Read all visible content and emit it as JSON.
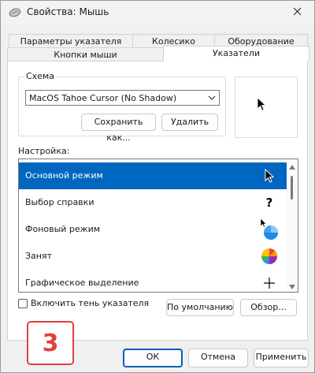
{
  "window": {
    "title": "Свойства: Мышь",
    "icon": "mouse-icon",
    "close_icon": "close-icon"
  },
  "tabs": {
    "row1": [
      "Параметры указателя",
      "Колесико",
      "Оборудование"
    ],
    "row2": [
      "Кнопки мыши",
      "Указатели"
    ],
    "active": "Указатели"
  },
  "scheme": {
    "group_label": "Схема",
    "selected": "MacOS Tahoe Cursor (No Shadow)",
    "save_label": "Сохранить как...",
    "delete_label": "Удалить"
  },
  "customize": {
    "label": "Настройка:",
    "items": [
      {
        "label": "Основной режим",
        "icon": "arrow-cursor-icon",
        "selected": true
      },
      {
        "label": "Выбор справки",
        "icon": "help-cursor-icon",
        "selected": false
      },
      {
        "label": "Фоновый режим",
        "icon": "working-in-background-cursor-icon",
        "selected": false
      },
      {
        "label": "Занят",
        "icon": "busy-cursor-icon",
        "selected": false
      },
      {
        "label": "Графическое выделение",
        "icon": "precision-select-cursor-icon",
        "selected": false
      }
    ]
  },
  "shadow_checkbox": {
    "label": "Включить тень указателя",
    "checked": false
  },
  "default_label": "По умолчанию",
  "browse_label": "Обзор...",
  "annotation_number": "3",
  "footer": {
    "ok": "ОК",
    "cancel": "Отмена",
    "apply": "Применить"
  },
  "colors": {
    "accent": "#0067c0",
    "annotation": "#e04040"
  }
}
